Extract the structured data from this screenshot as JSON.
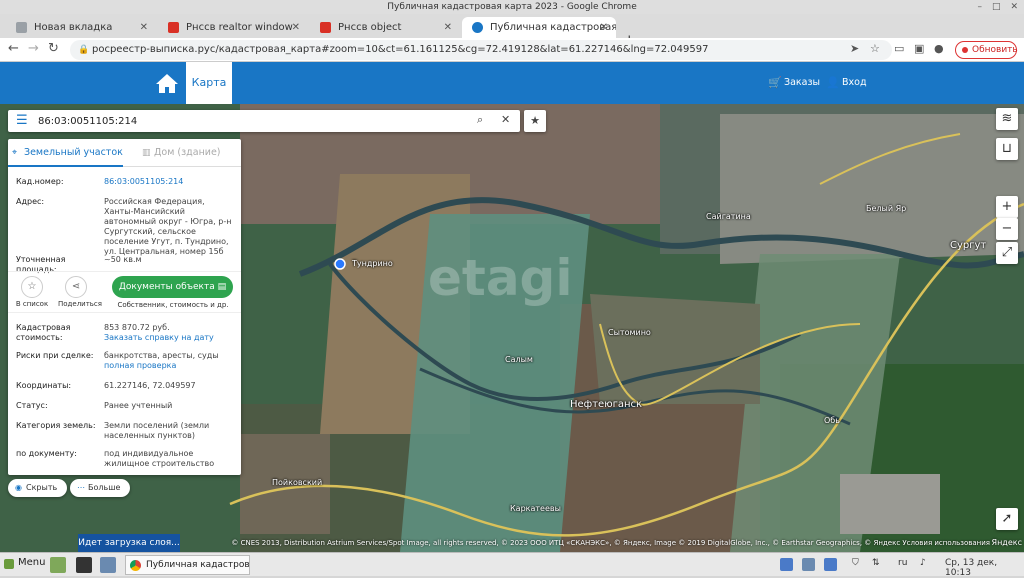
{
  "window": {
    "title": "Публичная кадастровая карта 2023 - Google Chrome"
  },
  "tabs": [
    {
      "label": "Новая вкладка",
      "color": "#9aa0a6"
    },
    {
      "label": "Рнссв realtor window",
      "color": "#d93025"
    },
    {
      "label": "Рнссв object",
      "color": "#d93025"
    },
    {
      "label": "Публичная кадастровая карт",
      "color": "#1976c5"
    }
  ],
  "toolbar": {
    "url": "росреестр-выписка.рус/кадастровая_карта#zoom=10&ct=61.161125&cg=72.419128&lat=61.227146&lng=72.049597",
    "update_label": "Обновить"
  },
  "header": {
    "nav_map": "Карта",
    "orders": "Заказы",
    "login": "Вход",
    "brand_color": "#1976c5"
  },
  "search": {
    "value": "86:03:0051105:214"
  },
  "panel": {
    "tab_land": "Земельный участок",
    "tab_building": "Дом (здание)",
    "cad_number_label": "Кад.номер:",
    "cad_number_value": "86:03:0051105:214",
    "address_label": "Адрес:",
    "address_value": "Российская Федерация, Ханты-Мансийский автономный округ - Югра, р-н Сургутский, сельское поселение Угут, п. Тундрино, ул. Центральная, номер 15б",
    "area_label": "Уточненная площадь:",
    "area_value": "~50 кв.м",
    "to_list": "В список",
    "share": "Поделиться",
    "docs_button": "Документы объекта",
    "docs_sub": "Собственник, стоимость и др.",
    "cost_label": "Кадастровая стоимость:",
    "cost_value": "853 870.72 руб.",
    "cost_link": "Заказать справку на дату",
    "risks_label": "Риски при сделке:",
    "risks_value": "банкротства, аресты, суды",
    "risks_link": "полная проверка",
    "coords_label": "Координаты:",
    "coords_value": "61.227146, 72.049597",
    "status_label": "Статус:",
    "status_value": "Ранее учтенный",
    "category_label": "Категория земель:",
    "category_value": "Земли поселений (земли населенных пунктов)",
    "doc_label": "по документу:",
    "doc_value": "под индивидуальное жилищное строительство"
  },
  "pills": {
    "hide": "Скрыть",
    "more": "Больше"
  },
  "map": {
    "labels": {
      "sytomino": "Сайгатина",
      "surgut": "Сургут",
      "nefteyugansk": "Нефтеюганск",
      "belyy_yar": "Белый Яр",
      "sitomino": "Сытомино",
      "kaymysovy": "Каркатеевы",
      "pojkovsky": "Пойковский",
      "salym": "Салым",
      "ob": "Обь",
      "tundrino": "Тундрино"
    },
    "watermark": "etagi",
    "loading": "Идет загрузка слоя...",
    "attribution": "© CNES 2013, Distribution Astrium Services/Spot Image, all rights reserved, © 2023 ООО ИТЦ «СКАНЭКС», © Яндекс, Image © 2019 DigitalGlobe, Inc., © Earthstar Geographics, © Яндекс Условия использования",
    "yandex": "Яндекс"
  },
  "taskbar": {
    "menu": "Menu",
    "task": "Публичная кадастровая...",
    "lang": "ru",
    "clock": "Ср, 13 дек, 10:13"
  }
}
